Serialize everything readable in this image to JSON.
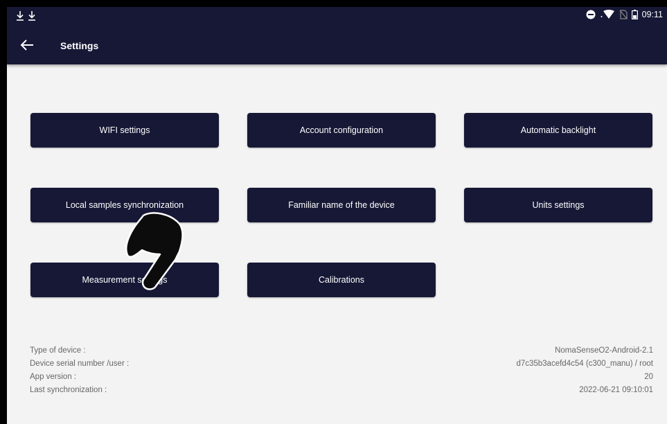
{
  "status_bar": {
    "time": "09:11",
    "left_icons": [
      "download-icon",
      "download-icon"
    ],
    "right_icons": [
      "do-not-disturb-icon",
      "wifi-icon",
      "no-sim-icon",
      "battery-icon"
    ]
  },
  "header": {
    "title": "Settings",
    "back_icon": "arrow-left-icon",
    "background": "#161836"
  },
  "buttons": {
    "wifi": "WIFI settings",
    "account": "Account configuration",
    "backlight": "Automatic backlight",
    "local_sync": "Local samples synchronization",
    "familiar_name": "Familiar name of the device",
    "units": "Units settings",
    "measurement": "Measurement settings",
    "calibrations": "Calibrations"
  },
  "device_info": {
    "type_label": "Type of device :",
    "type_value": "NomaSenseO2-Android-2.1",
    "serial_label": "Device serial number /user :",
    "serial_value": "d7c35b3acefd4c54 (c300_manu) / root",
    "app_version_label": "App version :",
    "app_version_value": "20",
    "last_sync_label": "Last synchronization :",
    "last_sync_value": "2022-06-21 09:10:01"
  },
  "overlay": {
    "pointer_icon": "hand-pointer-icon"
  },
  "colors": {
    "primary": "#161836",
    "background": "#f3f3f3",
    "info_text": "#666666"
  }
}
